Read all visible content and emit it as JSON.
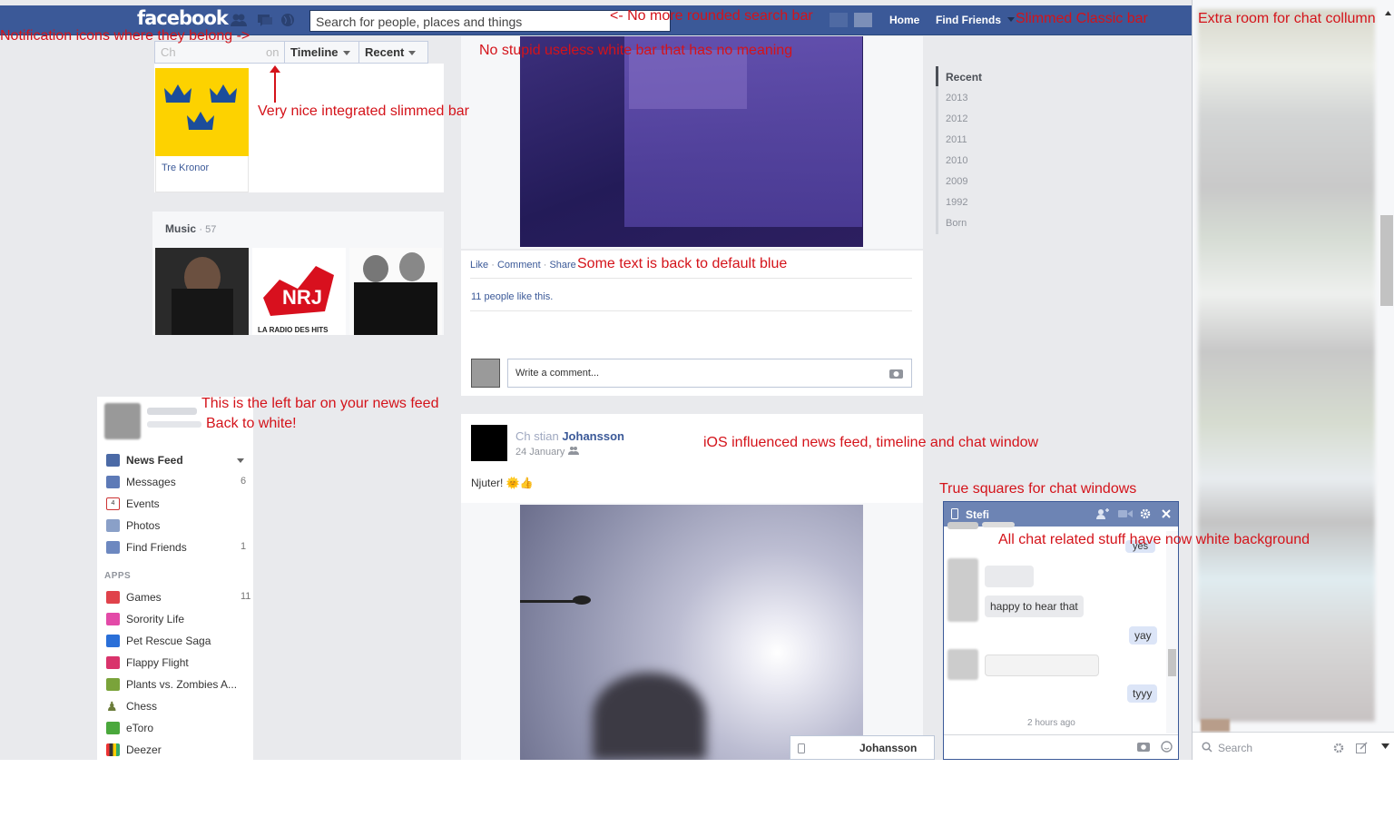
{
  "topbar": {
    "logo": "facebook",
    "search_placeholder": "Search for people, places and things",
    "home": "Home",
    "find_friends": "Find Friends"
  },
  "timeline": {
    "search_stub": "Ch",
    "search_stub_end": "on",
    "timeline_label": "Timeline",
    "recent_label": "Recent",
    "page_like_name": "Tre Kronor",
    "music_label": "Music",
    "music_count": "· 57",
    "nrj_caption": "LA RADIO DES HITS",
    "years": [
      "Recent",
      "2013",
      "2012",
      "2011",
      "2010",
      "2009",
      "1992",
      "Born"
    ]
  },
  "post1": {
    "actions": [
      "Like",
      "Comment",
      "Share"
    ],
    "likes": "11 people like this.",
    "comment_placeholder": "Write a comment..."
  },
  "post2": {
    "author": "Johansson",
    "author_prefix": "Ch  stian",
    "date": "24 January",
    "text": "Njuter! 🌞👍"
  },
  "leftnav": {
    "items": [
      {
        "label": "News Feed",
        "count": ""
      },
      {
        "label": "Messages",
        "count": "6"
      },
      {
        "label": "Events",
        "count": ""
      },
      {
        "label": "Photos",
        "count": ""
      },
      {
        "label": "Find Friends",
        "count": "1"
      }
    ],
    "apps_header": "APPS",
    "apps": [
      {
        "label": "Games",
        "count": "11"
      },
      {
        "label": "Sorority Life",
        "count": ""
      },
      {
        "label": "Pet Rescue Saga",
        "count": ""
      },
      {
        "label": "Flappy Flight",
        "count": ""
      },
      {
        "label": "Plants vs. Zombies A...",
        "count": ""
      },
      {
        "label": "Chess",
        "count": ""
      },
      {
        "label": "eToro",
        "count": ""
      },
      {
        "label": "Deezer",
        "count": ""
      }
    ]
  },
  "chat": {
    "title": "Stefi",
    "messages": {
      "yes": "yes",
      "happy": "happy to hear that",
      "yay": "yay",
      "tyyy": "tyyy"
    },
    "timestamp": "2 hours ago",
    "tab_name": "Johansson",
    "sidebar_search": "Search"
  },
  "annotations": {
    "notif": "Notification icons where they belong ->",
    "search": "<- No more rounded search bar",
    "slimmed": "Slimmed Classic bar",
    "extra_room": "Extra room for chat collumn",
    "white_bar": "No stupid useless white bar that has no meaning",
    "integrated": "Very nice integrated slimmed bar",
    "blue": "Some text is back to default blue",
    "leftbar1": "This is the left bar on your news feed",
    "leftbar2": "Back to white!",
    "ios": "iOS influenced news feed, timeline and chat window",
    "squares": "True squares for chat windows",
    "chat_white": "All chat related stuff have now white background"
  },
  "colors": {
    "fb_blue": "#3b5998",
    "annotation_red": "#d4131a",
    "page_bg": "#e9eaed"
  }
}
